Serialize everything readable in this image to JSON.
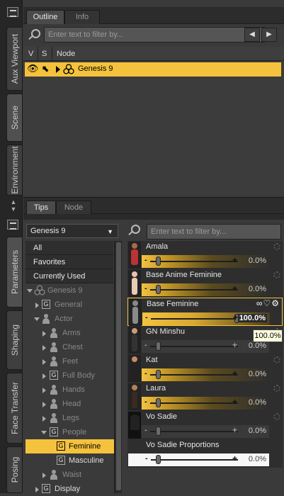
{
  "side_tabs": {
    "aux": "Aux Viewport",
    "scene": "Scene",
    "env": "Environment",
    "params": "Parameters",
    "shaping": "Shaping",
    "transfer": "Face Transfer",
    "posing": "Posing"
  },
  "scene_panel": {
    "tabs": [
      "Outline",
      "Info"
    ],
    "search_placeholder": "Enter text to filter by...",
    "columns": {
      "v": "V",
      "s": "S",
      "node": "Node"
    },
    "node": "Genesis 9"
  },
  "middle_tabs": [
    "Tips",
    "Node"
  ],
  "params": {
    "figure_select": "Genesis 9",
    "search_placeholder": "Enter text to filter by...",
    "categories": [
      "All",
      "Favorites",
      "Currently Used"
    ],
    "tree": [
      {
        "label": "Genesis 9"
      },
      {
        "label": "General"
      },
      {
        "label": "Actor"
      },
      {
        "label": "Arms"
      },
      {
        "label": "Chest"
      },
      {
        "label": "Feet"
      },
      {
        "label": "Full Body"
      },
      {
        "label": "Hands"
      },
      {
        "label": "Head"
      },
      {
        "label": "Legs"
      },
      {
        "label": "People"
      },
      {
        "label": "Feminine"
      },
      {
        "label": "Masculine"
      },
      {
        "label": "Waist"
      },
      {
        "label": "Display"
      }
    ],
    "sliders": [
      {
        "name": "Amala",
        "value": "0.0%",
        "level": 0
      },
      {
        "name": "Base Anime Feminine",
        "value": "0.0%",
        "level": 0
      },
      {
        "name": "Base Feminine",
        "value": "100.0%",
        "level": 1
      },
      {
        "name": "GN Minshu",
        "value": "0.0%",
        "level": 0
      },
      {
        "name": "Kat",
        "value": "0.0%",
        "level": 0
      },
      {
        "name": "Laura",
        "value": "0.0%",
        "level": 0
      },
      {
        "name": "Vo Sadie",
        "value": "0.0%",
        "level": 0
      },
      {
        "name": "Vo Sadie Proportions",
        "value": "0.0%",
        "level": 0
      }
    ],
    "tooltip": "100.0%"
  },
  "colors": {
    "accent": "#f4c23c",
    "panel": "#3a3a3a"
  }
}
